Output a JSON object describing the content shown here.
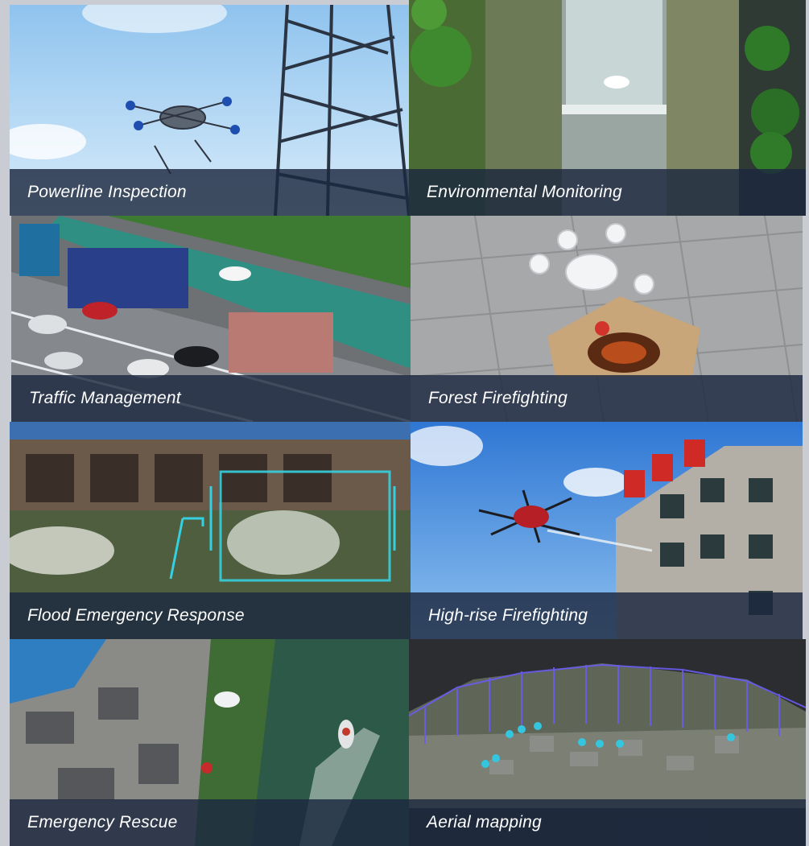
{
  "tiles": [
    {
      "caption": "Powerline Inspection"
    },
    {
      "caption": "Environmental Monitoring"
    },
    {
      "caption": "Traffic Management"
    },
    {
      "caption": "Forest Firefighting"
    },
    {
      "caption": "Flood Emergency Response"
    },
    {
      "caption": "High-rise Firefighting"
    },
    {
      "caption": "Emergency Rescue"
    },
    {
      "caption": "Aerial mapping"
    }
  ],
  "colors": {
    "caption_band": "#1c2840",
    "caption_text": "#ffffff",
    "page_background": "#c9ccd2"
  }
}
